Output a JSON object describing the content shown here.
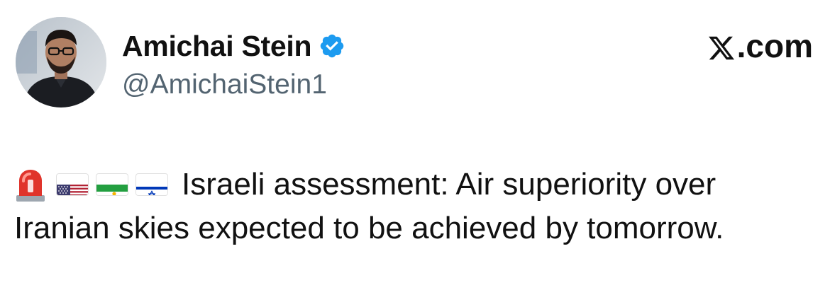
{
  "author": {
    "display_name": "Amichai Stein",
    "handle": "@AmichaiStein1",
    "verified": true,
    "avatar_icon": "profile-photo"
  },
  "brand": {
    "label": ".com",
    "logo_icon": "x-logo-icon"
  },
  "tweet": {
    "emojis": [
      "siren-icon",
      "us-flag-icon",
      "iran-lion-sun-flag-icon",
      "israel-flag-icon"
    ],
    "line1": "Israeli assessment: Air superiority over",
    "line2": "Iranian skies expected to be achieved by tomorrow."
  },
  "colors": {
    "verified_badge": "#1d9bf0",
    "handle_text": "#536471",
    "text": "#111111"
  }
}
